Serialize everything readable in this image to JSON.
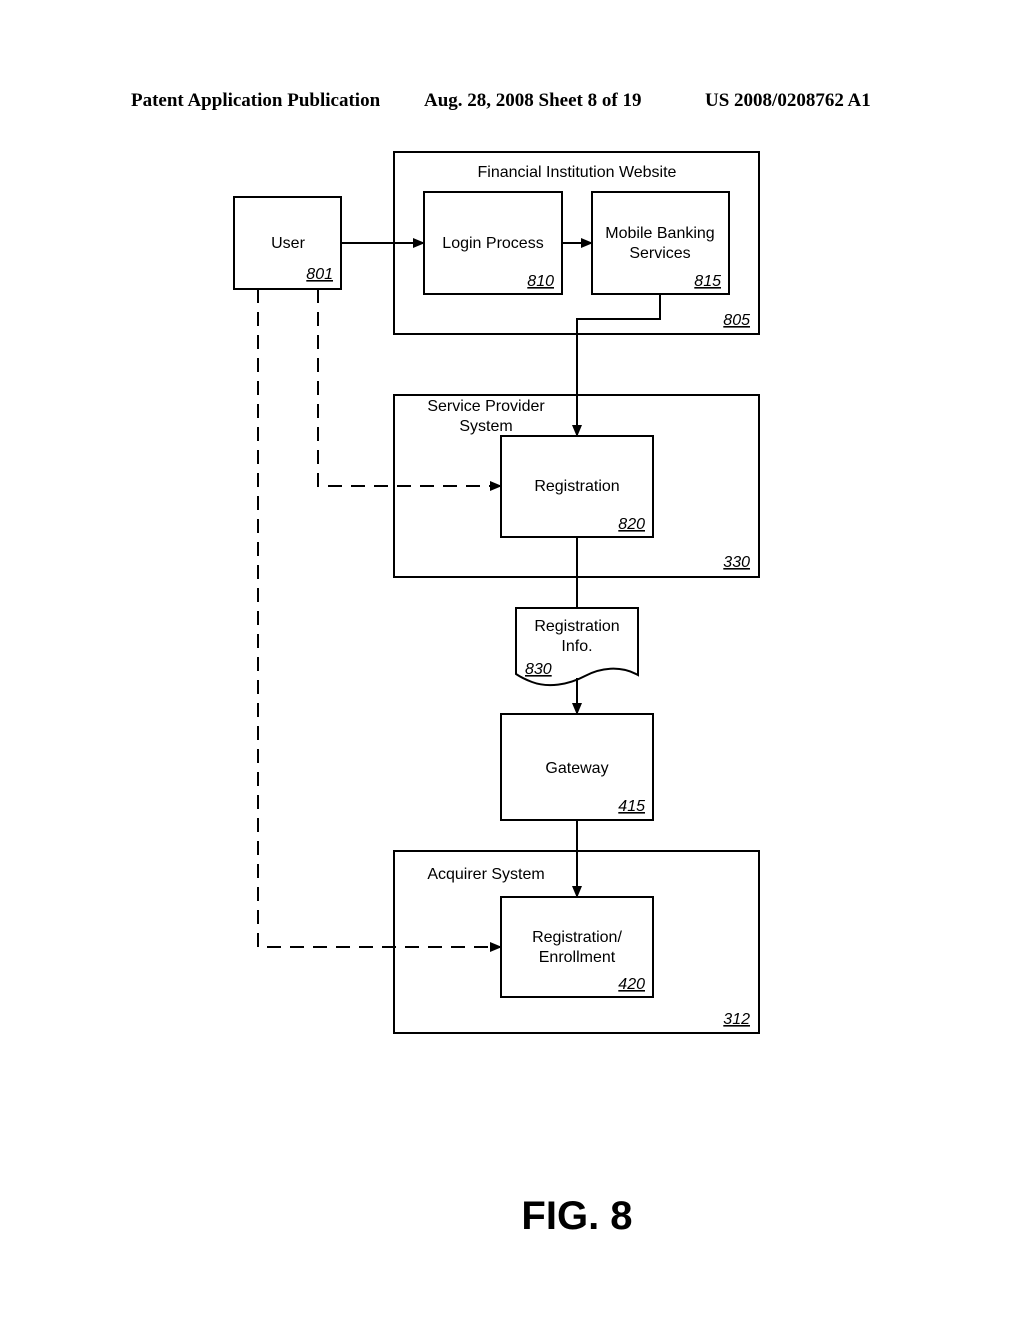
{
  "header": {
    "publication": "Patent Application Publication",
    "date_sheet": "Aug. 28, 2008  Sheet 8 of 19",
    "patent_number": "US 2008/0208762 A1"
  },
  "figure_label": "FIG. 8",
  "nodes": {
    "user": {
      "label": "User",
      "ref": "801"
    },
    "fi_website": {
      "label": "Financial Institution Website",
      "ref": "805"
    },
    "login": {
      "label": "Login Process",
      "ref": "810"
    },
    "mobile_banking": {
      "label_line1": "Mobile Banking",
      "label_line2": "Services",
      "ref": "815"
    },
    "service_provider": {
      "label_line1": "Service Provider",
      "label_line2": "System",
      "ref": "330"
    },
    "registration": {
      "label": "Registration",
      "ref": "820"
    },
    "registration_info": {
      "label_line1": "Registration",
      "label_line2": "Info.",
      "ref": "830"
    },
    "gateway": {
      "label": "Gateway",
      "ref": "415"
    },
    "acquirer": {
      "label": "Acquirer System",
      "ref": "312"
    },
    "enrollment": {
      "label_line1": "Registration/",
      "label_line2": "Enrollment",
      "ref": "420"
    }
  },
  "edges": [
    {
      "from": "user",
      "to": "login",
      "style": "solid"
    },
    {
      "from": "login",
      "to": "mobile_banking",
      "style": "solid"
    },
    {
      "from": "mobile_banking",
      "to": "registration",
      "style": "solid"
    },
    {
      "from": "user",
      "to": "registration",
      "style": "dashed"
    },
    {
      "from": "registration",
      "to": "registration_info",
      "style": "solid"
    },
    {
      "from": "registration_info",
      "to": "gateway",
      "style": "solid"
    },
    {
      "from": "gateway",
      "to": "enrollment",
      "style": "solid"
    },
    {
      "from": "user",
      "to": "enrollment",
      "style": "dashed"
    }
  ]
}
